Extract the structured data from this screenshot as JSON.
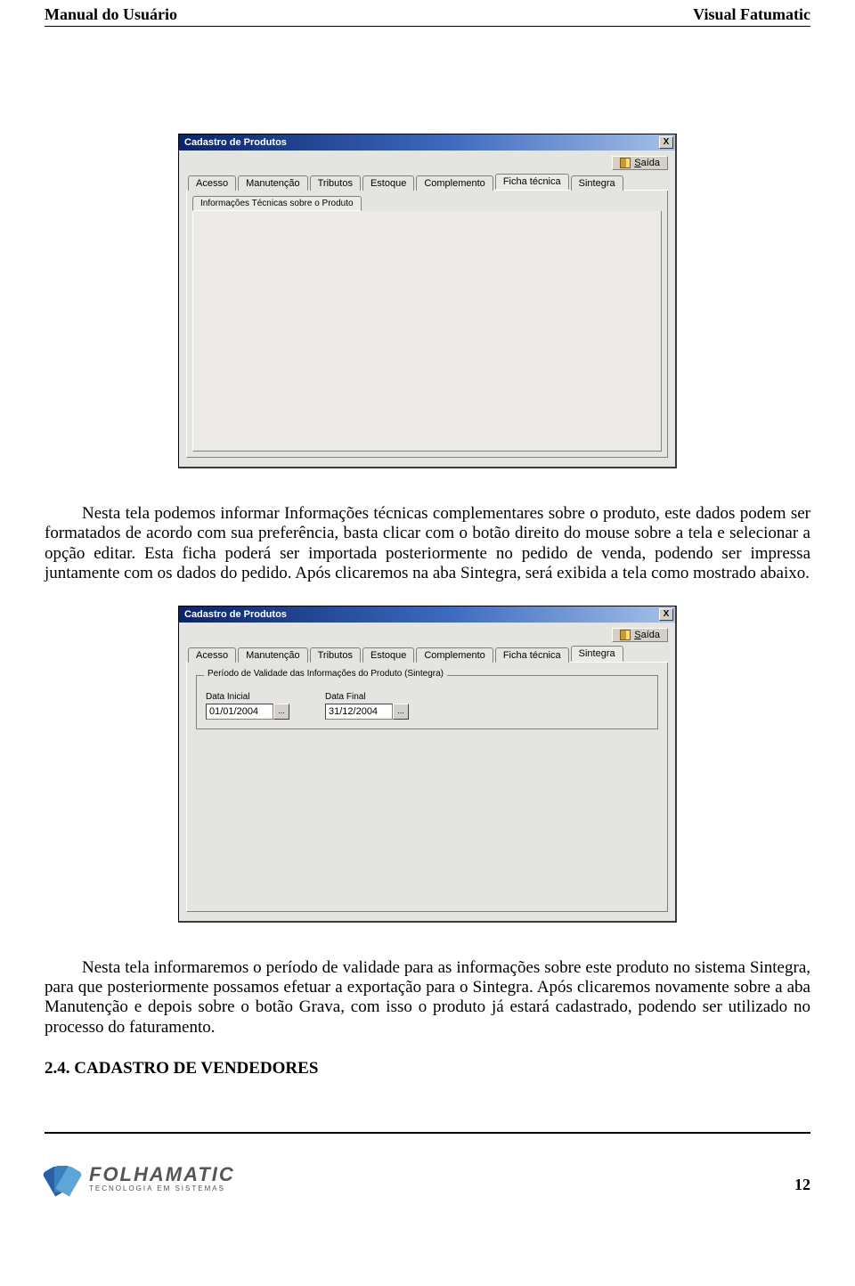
{
  "header": {
    "left": "Manual do Usuário",
    "right": "Visual Fatumatic"
  },
  "dialog1": {
    "title": "Cadastro de Produtos",
    "close": "X",
    "saida_label": "Saída",
    "tabs": [
      "Acesso",
      "Manutenção",
      "Tributos",
      "Estoque",
      "Complemento",
      "Ficha técnica",
      "Sintegra"
    ],
    "active_tab_index": 5,
    "sub_tab": "Informações Técnicas sobre o Produto"
  },
  "para1": "Nesta tela podemos informar Informações técnicas complementares sobre o produto, este dados podem ser formatados de acordo com sua preferência, basta clicar com o botão direito do mouse sobre a tela e selecionar a opção editar. Esta ficha poderá ser importada posteriormente no pedido de venda, podendo ser impressa juntamente com os dados do pedido. Após clicaremos na aba Sintegra, será exibida a tela como mostrado abaixo.",
  "dialog2": {
    "title": "Cadastro de Produtos",
    "close": "X",
    "saida_label": "Saída",
    "tabs": [
      "Acesso",
      "Manutenção",
      "Tributos",
      "Estoque",
      "Complemento",
      "Ficha técnica",
      "Sintegra"
    ],
    "active_tab_index": 6,
    "group_legend": "Período de Validade das Informações do Produto (Sintegra)",
    "data_inicial_label": "Data Inicial",
    "data_inicial_value": "01/01/2004",
    "data_final_label": "Data Final",
    "data_final_value": "31/12/2004",
    "picker_btn": "..."
  },
  "para2": "Nesta tela informaremos o período de validade para as informações sobre este produto no sistema Sintegra, para que posteriormente possamos efetuar a exportação para o Sintegra. Após clicaremos novamente sobre a aba Manutenção e depois sobre o botão Grava, com isso o produto já estará cadastrado, podendo ser utilizado no processo do faturamento.",
  "section_heading": "2.4. CADASTRO DE VENDEDORES",
  "footer": {
    "logo_text": "FOLHAMATIC",
    "logo_tagline": "TECNOLOGIA EM SISTEMAS",
    "page_number": "12"
  }
}
